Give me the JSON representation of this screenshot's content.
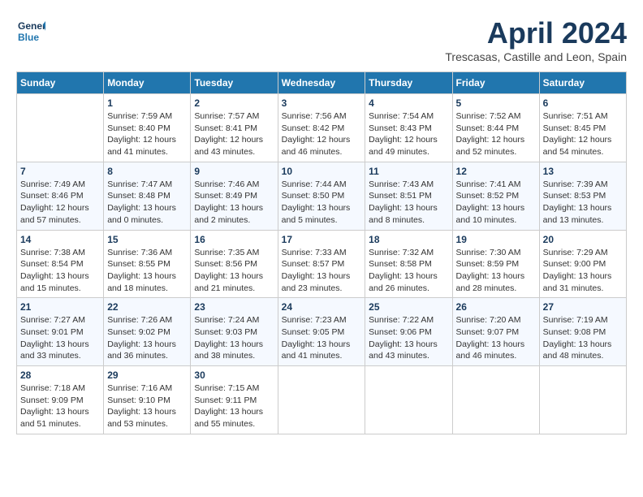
{
  "logo": {
    "text_general": "General",
    "text_blue": "Blue"
  },
  "title": "April 2024",
  "subtitle": "Trescasas, Castille and Leon, Spain",
  "headers": [
    "Sunday",
    "Monday",
    "Tuesday",
    "Wednesday",
    "Thursday",
    "Friday",
    "Saturday"
  ],
  "weeks": [
    [
      {
        "day": "",
        "info": ""
      },
      {
        "day": "1",
        "info": "Sunrise: 7:59 AM\nSunset: 8:40 PM\nDaylight: 12 hours\nand 41 minutes."
      },
      {
        "day": "2",
        "info": "Sunrise: 7:57 AM\nSunset: 8:41 PM\nDaylight: 12 hours\nand 43 minutes."
      },
      {
        "day": "3",
        "info": "Sunrise: 7:56 AM\nSunset: 8:42 PM\nDaylight: 12 hours\nand 46 minutes."
      },
      {
        "day": "4",
        "info": "Sunrise: 7:54 AM\nSunset: 8:43 PM\nDaylight: 12 hours\nand 49 minutes."
      },
      {
        "day": "5",
        "info": "Sunrise: 7:52 AM\nSunset: 8:44 PM\nDaylight: 12 hours\nand 52 minutes."
      },
      {
        "day": "6",
        "info": "Sunrise: 7:51 AM\nSunset: 8:45 PM\nDaylight: 12 hours\nand 54 minutes."
      }
    ],
    [
      {
        "day": "7",
        "info": "Sunrise: 7:49 AM\nSunset: 8:46 PM\nDaylight: 12 hours\nand 57 minutes."
      },
      {
        "day": "8",
        "info": "Sunrise: 7:47 AM\nSunset: 8:48 PM\nDaylight: 13 hours\nand 0 minutes."
      },
      {
        "day": "9",
        "info": "Sunrise: 7:46 AM\nSunset: 8:49 PM\nDaylight: 13 hours\nand 2 minutes."
      },
      {
        "day": "10",
        "info": "Sunrise: 7:44 AM\nSunset: 8:50 PM\nDaylight: 13 hours\nand 5 minutes."
      },
      {
        "day": "11",
        "info": "Sunrise: 7:43 AM\nSunset: 8:51 PM\nDaylight: 13 hours\nand 8 minutes."
      },
      {
        "day": "12",
        "info": "Sunrise: 7:41 AM\nSunset: 8:52 PM\nDaylight: 13 hours\nand 10 minutes."
      },
      {
        "day": "13",
        "info": "Sunrise: 7:39 AM\nSunset: 8:53 PM\nDaylight: 13 hours\nand 13 minutes."
      }
    ],
    [
      {
        "day": "14",
        "info": "Sunrise: 7:38 AM\nSunset: 8:54 PM\nDaylight: 13 hours\nand 15 minutes."
      },
      {
        "day": "15",
        "info": "Sunrise: 7:36 AM\nSunset: 8:55 PM\nDaylight: 13 hours\nand 18 minutes."
      },
      {
        "day": "16",
        "info": "Sunrise: 7:35 AM\nSunset: 8:56 PM\nDaylight: 13 hours\nand 21 minutes."
      },
      {
        "day": "17",
        "info": "Sunrise: 7:33 AM\nSunset: 8:57 PM\nDaylight: 13 hours\nand 23 minutes."
      },
      {
        "day": "18",
        "info": "Sunrise: 7:32 AM\nSunset: 8:58 PM\nDaylight: 13 hours\nand 26 minutes."
      },
      {
        "day": "19",
        "info": "Sunrise: 7:30 AM\nSunset: 8:59 PM\nDaylight: 13 hours\nand 28 minutes."
      },
      {
        "day": "20",
        "info": "Sunrise: 7:29 AM\nSunset: 9:00 PM\nDaylight: 13 hours\nand 31 minutes."
      }
    ],
    [
      {
        "day": "21",
        "info": "Sunrise: 7:27 AM\nSunset: 9:01 PM\nDaylight: 13 hours\nand 33 minutes."
      },
      {
        "day": "22",
        "info": "Sunrise: 7:26 AM\nSunset: 9:02 PM\nDaylight: 13 hours\nand 36 minutes."
      },
      {
        "day": "23",
        "info": "Sunrise: 7:24 AM\nSunset: 9:03 PM\nDaylight: 13 hours\nand 38 minutes."
      },
      {
        "day": "24",
        "info": "Sunrise: 7:23 AM\nSunset: 9:05 PM\nDaylight: 13 hours\nand 41 minutes."
      },
      {
        "day": "25",
        "info": "Sunrise: 7:22 AM\nSunset: 9:06 PM\nDaylight: 13 hours\nand 43 minutes."
      },
      {
        "day": "26",
        "info": "Sunrise: 7:20 AM\nSunset: 9:07 PM\nDaylight: 13 hours\nand 46 minutes."
      },
      {
        "day": "27",
        "info": "Sunrise: 7:19 AM\nSunset: 9:08 PM\nDaylight: 13 hours\nand 48 minutes."
      }
    ],
    [
      {
        "day": "28",
        "info": "Sunrise: 7:18 AM\nSunset: 9:09 PM\nDaylight: 13 hours\nand 51 minutes."
      },
      {
        "day": "29",
        "info": "Sunrise: 7:16 AM\nSunset: 9:10 PM\nDaylight: 13 hours\nand 53 minutes."
      },
      {
        "day": "30",
        "info": "Sunrise: 7:15 AM\nSunset: 9:11 PM\nDaylight: 13 hours\nand 55 minutes."
      },
      {
        "day": "",
        "info": ""
      },
      {
        "day": "",
        "info": ""
      },
      {
        "day": "",
        "info": ""
      },
      {
        "day": "",
        "info": ""
      }
    ]
  ]
}
